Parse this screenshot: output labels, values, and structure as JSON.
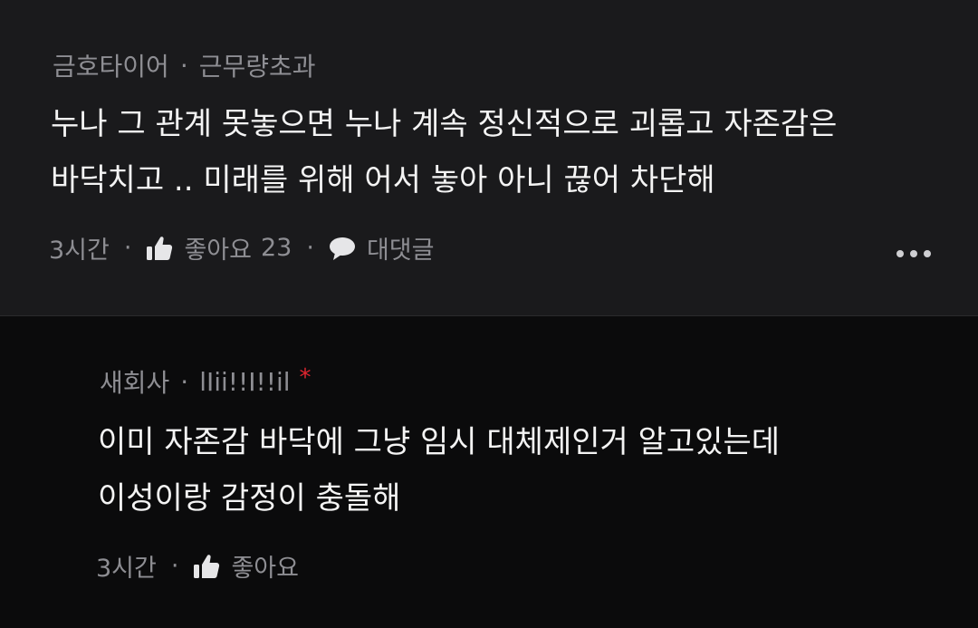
{
  "comment": {
    "author": "금호타이어",
    "handle": "근무량초과",
    "lines": [
      "누나 그 관계 못놓으면 누나 계속 정신적으로 괴롭고 자존감은",
      "바닥치고 .. 미래를 위해 어서 놓아 아니 끊어 차단해"
    ],
    "time": "3시간",
    "like_label": "좋아요",
    "like_count": "23",
    "reply_label": "대댓글"
  },
  "reply": {
    "author": "새회사",
    "handle": "lIii!!I!!il",
    "star": "*",
    "lines": [
      "이미 자존감 바닥에 그냥 임시 대체제인거 알고있는데",
      "이성이랑 감정이 충돌해"
    ],
    "time": "3시간",
    "like_label": "좋아요"
  },
  "separator": "·",
  "icons": {
    "like": "thumbs-up-icon",
    "reply": "speech-bubble-icon",
    "more": "more-horizontal-icon"
  },
  "colors": {
    "background": "#0b0b0c",
    "top_comment_background": "#1a1a1c",
    "text": "#f4f4f4",
    "meta": "#8e8e93",
    "accent_star": "#e0252f"
  }
}
